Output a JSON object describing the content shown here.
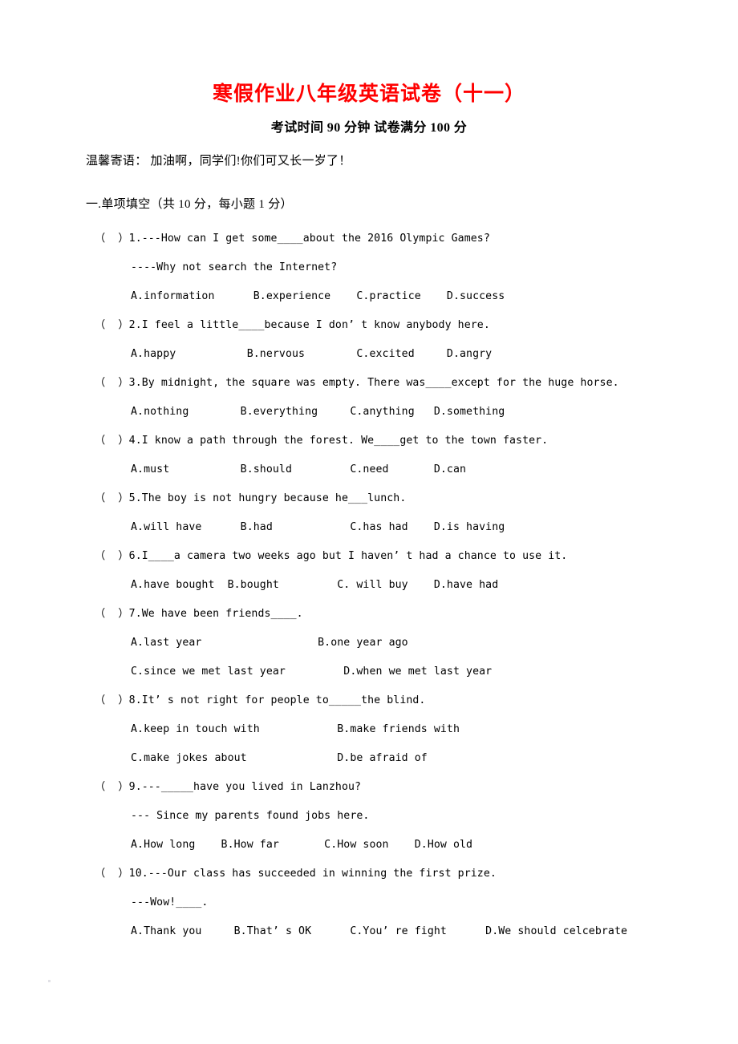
{
  "document": {
    "title": "寒假作业八年级英语试卷（十一）",
    "subtitle": "考试时间 90 分钟   试卷满分 100 分",
    "note": "温馨寄语：  加油啊，同学们!你们可又长一岁了！",
    "title_color": "#ff0000",
    "section_heading": "一.单项填空（共 10 分，每小题 1 分）"
  },
  "questions": [
    {
      "marker": "（  ）1.",
      "lines": [
        "（  ）1.---How can I get some____about the 2016 Olympic Games?",
        "----Why not search the Internet?"
      ],
      "options": [
        "A.information",
        "B.experience",
        "C.practice",
        "D.success"
      ],
      "options_line": "A.information      B.experience    C.practice    D.success"
    },
    {
      "marker": "（  ）2.",
      "lines": [
        "（  ）2.I feel a little____because I don’ t know anybody here."
      ],
      "options": [
        "A.happy",
        "B.nervous",
        "C.excited",
        "D.angry"
      ],
      "options_line": "A.happy           B.nervous        C.excited     D.angry"
    },
    {
      "marker": "（  ）3.",
      "lines": [
        "（  ）3.By midnight, the square was empty. There was____except for the huge horse."
      ],
      "options": [
        "A.nothing",
        "B.everything",
        "C.anything",
        "D.something"
      ],
      "options_line": "A.nothing        B.everything     C.anything   D.something"
    },
    {
      "marker": "（  ）4.",
      "lines": [
        "（  ）4.I know a path through the forest. We____get to the town faster."
      ],
      "options": [
        "A.must",
        "B.should",
        "C.need",
        "D.can"
      ],
      "options_line": "A.must           B.should         C.need       D.can"
    },
    {
      "marker": "（  ）5.",
      "lines": [
        "（  ）5.The boy is not hungry because he___lunch."
      ],
      "options": [
        "A.will have",
        "B.had",
        "C.has had",
        "D.is having"
      ],
      "options_line": "A.will have      B.had            C.has had    D.is having"
    },
    {
      "marker": "（  ）6.",
      "lines": [
        "（  ）6.I____a camera two weeks ago but I haven’ t had a chance to use it."
      ],
      "options": [
        "A.have bought",
        "B.bought",
        "C. will buy",
        "D.have had"
      ],
      "options_line": "A.have bought  B.bought         C. will buy    D.have had"
    },
    {
      "marker": "（  ）7.",
      "lines": [
        "（  ）7.We have been friends____."
      ],
      "options": [
        "A.last year",
        "B.one year ago",
        "C.since we met last year",
        "D.when we met last year"
      ],
      "options_line_1": "A.last year                  B.one year ago",
      "options_line_2": "C.since we met last year         D.when we met last year"
    },
    {
      "marker": "（  ）8.",
      "lines": [
        "（  ）8.It’ s not right for people to_____the blind."
      ],
      "options": [
        "A.keep in touch with",
        "B.make friends with",
        "C.make jokes about",
        "D.be afraid of"
      ],
      "options_line_1": "A.keep in touch with            B.make friends with",
      "options_line_2": "C.make jokes about              D.be afraid of"
    },
    {
      "marker": "（  ）9.",
      "lines": [
        "（  ）9.---_____have you lived in Lanzhou?",
        "--- Since my parents found jobs here."
      ],
      "options": [
        "A.How long",
        "B.How far",
        "C.How soon",
        "D.How old"
      ],
      "options_line": "A.How long    B.How far       C.How soon    D.How old"
    },
    {
      "marker": "（  ）10.",
      "lines": [
        "（  ）10.---Our class has succeeded in winning the first prize.",
        "---Wow!____."
      ],
      "options": [
        "A.Thank you",
        "B.That’ s OK",
        "C.You’ re fight",
        "D.We should celcebrate"
      ],
      "options_line": "A.Thank you     B.That’ s OK      C.You’ re fight      D.We should celcebrate"
    }
  ]
}
